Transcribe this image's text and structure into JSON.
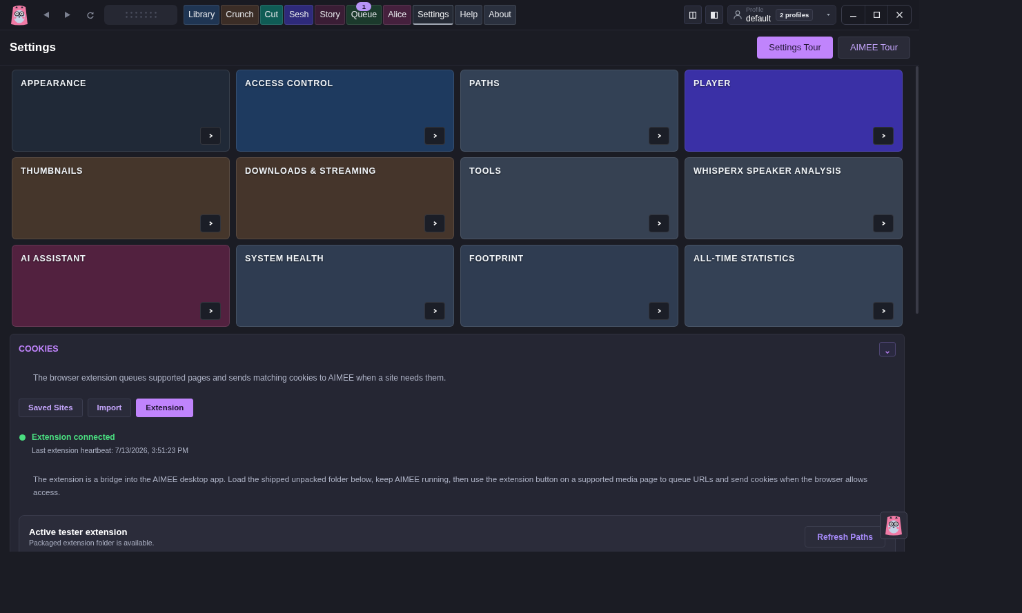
{
  "top_bar": {
    "nav_tabs": [
      {
        "label": "Library",
        "color": "#1f3553",
        "selected": false
      },
      {
        "label": "Crunch",
        "color": "#3b2d26",
        "selected": false
      },
      {
        "label": "Cut",
        "color": "#0f5c55",
        "selected": false
      },
      {
        "label": "Sesh",
        "color": "#2e2a7a",
        "selected": false
      },
      {
        "label": "Story",
        "color": "#3a1d35",
        "selected": false
      },
      {
        "label": "Queue",
        "color": "#1b3a2c",
        "selected": false,
        "badge": "1"
      },
      {
        "label": "Alice",
        "color": "#45203d",
        "selected": false
      },
      {
        "label": "Settings",
        "color": "#252a35",
        "selected": true
      },
      {
        "label": "Help",
        "color": "#2a303e",
        "selected": false
      },
      {
        "label": "About",
        "color": "#2a303e",
        "selected": false
      }
    ],
    "profile": {
      "caption": "Profile",
      "name": "default",
      "count_badge": "2 profiles"
    }
  },
  "page_header": {
    "title": "Settings",
    "buttons": [
      {
        "label": "Settings Tour",
        "kind": "primary"
      },
      {
        "label": "AIMEE Tour",
        "kind": "secondary"
      }
    ]
  },
  "settings_cards": [
    {
      "title": "APPEARANCE",
      "color": "#202937"
    },
    {
      "title": "ACCESS CONTROL",
      "color": "#1e3a5f"
    },
    {
      "title": "PATHS",
      "color": "#334155"
    },
    {
      "title": "PLAYER",
      "color": "#3a30a6"
    },
    {
      "title": "THUMBNAILS",
      "color": "#45362b"
    },
    {
      "title": "DOWNLOADS & STREAMING",
      "color": "#45352b"
    },
    {
      "title": "TOOLS",
      "color": "#364152"
    },
    {
      "title": "WHISPERX SPEAKER ANALYSIS",
      "color": "#374151"
    },
    {
      "title": "AI ASSISTANT",
      "color": "#52213f"
    },
    {
      "title": "SYSTEM HEALTH",
      "color": "#2f3c51"
    },
    {
      "title": "FOOTPRINT",
      "color": "#2f3c51"
    },
    {
      "title": "ALL-TIME STATISTICS",
      "color": "#344155"
    }
  ],
  "cookies_panel": {
    "title": "COOKIES",
    "expanded": true,
    "description": "The browser extension queues supported pages and sends matching cookies to AIMEE when a site needs them.",
    "tabs": [
      {
        "label": "Saved Sites",
        "selected": false
      },
      {
        "label": "Import",
        "selected": false
      },
      {
        "label": "Extension",
        "selected": true
      }
    ],
    "status": {
      "connected": true,
      "label": "Extension connected",
      "detail": "Last extension heartbeat: 7/13/2026, 3:51:23 PM"
    },
    "info": "The extension is a bridge into the AIMEE desktop app. Load the shipped unpacked folder below, keep AIMEE running, then use the extension button on a supported media page to queue URLs and send cookies when the browser allows access.",
    "extension_card": {
      "title": "Active tester extension",
      "subtitle": "Packaged extension folder is available.",
      "button": "Refresh Paths"
    }
  }
}
